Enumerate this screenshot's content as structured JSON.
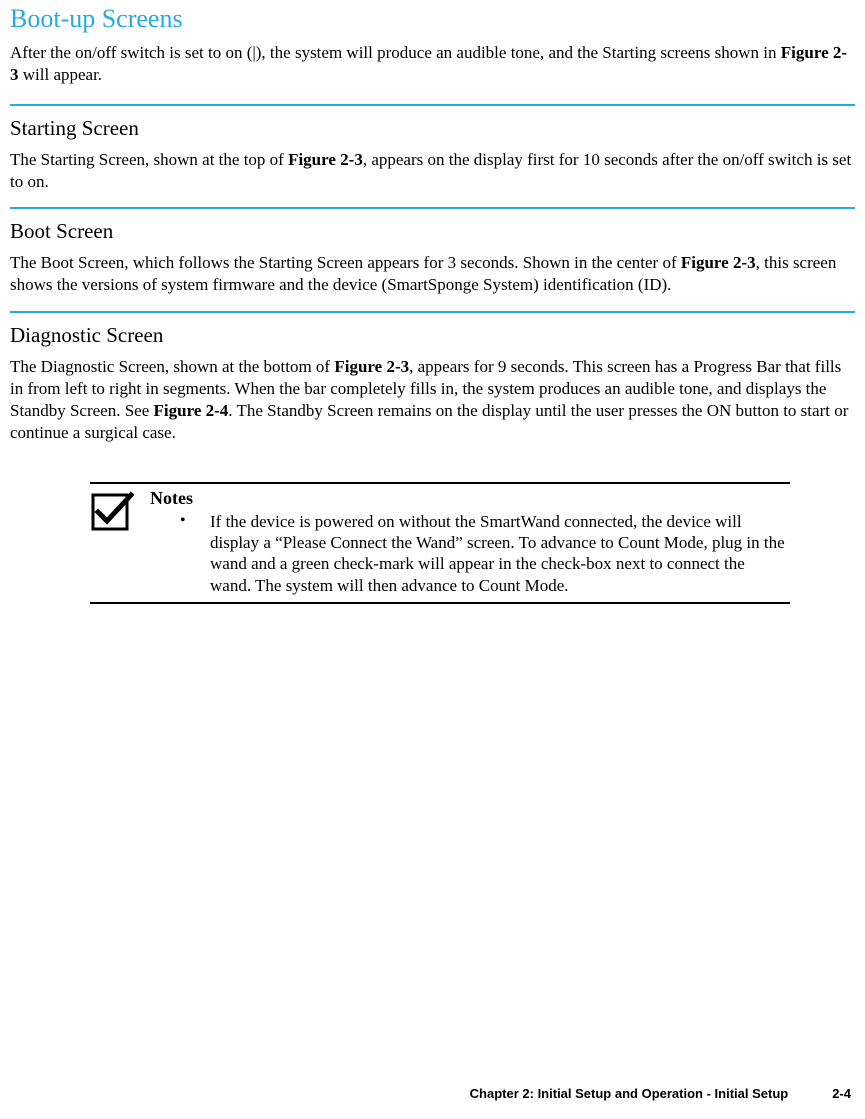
{
  "title": "Boot-up Screens",
  "intro_parts": {
    "p1": "After the on/off switch is set to on (|), the system will produce an audible tone, and the Starting screens shown in ",
    "b1": "Figure 2-3",
    "p2": " will appear."
  },
  "sections": {
    "s1": {
      "heading": "Starting Screen",
      "body_parts": {
        "p1": "The Starting Screen, shown at the top of ",
        "b1": "Figure 2-3",
        "p2": ", appears on the display first for 10 seconds after the on/off switch is set to on."
      }
    },
    "s2": {
      "heading": "Boot Screen",
      "body_parts": {
        "p1": "The Boot Screen, which follows the Starting Screen appears for 3 seconds. Shown in the center of ",
        "b1": "Figure 2-3",
        "p2": ", this screen shows the versions of system firmware and the device (SmartSponge System) identification (ID)."
      }
    },
    "s3": {
      "heading": "Diagnostic Screen",
      "body_parts": {
        "p1": "The Diagnostic Screen, shown at the bottom of ",
        "b1": "Figure 2-3",
        "p2": ", appears for 9 seconds. This screen has a Progress Bar that fills in from left to right in segments. When the bar completely fills in, the system produces an audible tone, and displays the Standby Screen. See ",
        "b2": "Figure 2-4",
        "p3": ". The Standby Screen remains on the display until the user presses the ON button to start or continue a surgical case."
      }
    }
  },
  "note": {
    "title": "Notes",
    "bullet": "•",
    "text": "If the device is powered on without the SmartWand connected, the device will display a “Please Connect the Wand” screen. To advance to Count Mode, plug in the wand and a green check-mark will appear in the check-box next to connect the wand. The system will then advance to Count Mode."
  },
  "footer": {
    "chapter": "Chapter 2: Initial Setup and Operation - Initial Setup",
    "page": "2-4"
  }
}
